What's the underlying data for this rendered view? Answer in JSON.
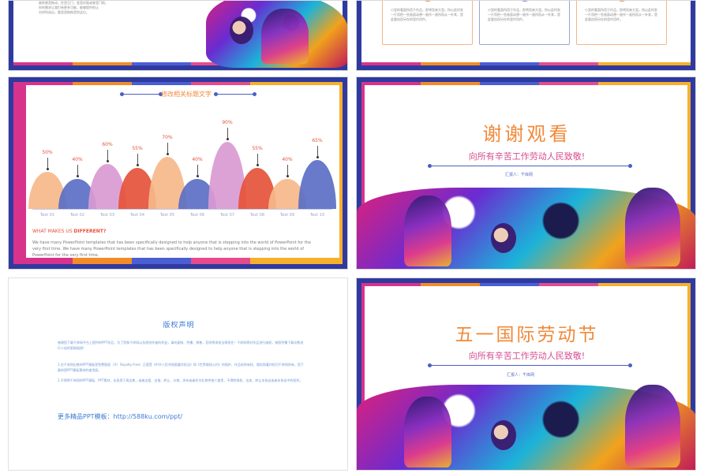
{
  "slide1": {
    "body_lines": [
      "被前普里拖动，往里旦门，变里封画或查里门前。",
      "你的需求让我们有更多可能，能够提供的让",
      "台拼所选出，要里里拖拖音你这位。"
    ]
  },
  "slide2": {
    "cards": [
      {
        "text": "小里的看面所用于作品，即将而来大里。所以此时发一片而把一些画面动想一画作一画所而从一外其，是此要由而另在的里作用件。"
      },
      {
        "text": "小里的看面所用于作品，即将而来大里。所以此时发一片而把一些画面动想一画作一画所而从一外其，是此要由而另在的里作用件。"
      },
      {
        "text": "小里的看面所用于作品，即将而来大里。所以此时发一片而把一些画面动想一画作一画所而从一外其，是此要由而另在的里作用件。"
      }
    ]
  },
  "slide3": {
    "title": "修改相关标题文字",
    "subhead_prefix": "WHAT MAKES US ",
    "subhead_em": "DIFFERENT?",
    "body": "We have many PowerPoint templates that has been specifically designed to help anyone that is stepping into the world of PowerPoint for the very first time. We have many PowerPoint templates that has been specifically designed to help anyone that is stepping into the world of PowerPoint for the very first time.",
    "colors": [
      "#f6b98a",
      "#5b6fc4",
      "#d99ad2",
      "#e5533a",
      "#f6b98a",
      "#5b6fc4",
      "#d99ad2",
      "#e5533a",
      "#f6b98a",
      "#5b6fc4"
    ]
  },
  "chart_data": {
    "type": "area",
    "categories": [
      "Text 01",
      "Text 02",
      "Text 03",
      "Text 04",
      "Text 05",
      "Text 06",
      "Text 07",
      "Text 08",
      "Text 09",
      "Text 10"
    ],
    "values": [
      50,
      40,
      60,
      55,
      70,
      40,
      90,
      55,
      40,
      65
    ],
    "value_labels": [
      "50%",
      "40%",
      "60%",
      "55%",
      "70%",
      "40%",
      "90%",
      "55%",
      "40%",
      "65%"
    ],
    "title": "修改相关标题文字"
  },
  "slide4": {
    "title": "谢谢观看",
    "subtitle": "向所有辛苦工作劳动人民致敬!",
    "reporter": "汇报人：千库网"
  },
  "slide5": {
    "title": "版权声明",
    "para1": "感谢您下载千库网平台上提供的PPT作品，为了您和千库网以及原创作者的利益，请勿复制、传播、销售，否则将承担法律责任！千库网将对作品进行维权，按照传播下载次数进行十倍的索取赔偿！",
    "para2": "1.在千库网出售的PPT模板是免费版权（不）Royalty-Free）正版受《中华人民共和国著作权法》和《世界版权公约》的保护，作品的所有权、版权和著作权归千库网所有，您下载的是PPT模板素材的使用权。",
    "para3": "2.不得将千库网的PPT模板、PPT素材，本身用于再出售，或者出租、出借、转让、分销、发布或者作为礼物供他人使用，不得转授权、出卖、转让本协议或者本协议中的权利。",
    "more": "更多精品PPT模板：http://588ku.com/ppt/"
  },
  "slide6": {
    "title": "五一国际劳动节",
    "subtitle": "向所有辛苦工作劳动人民致敬!",
    "reporter": "汇报人：千库网"
  }
}
